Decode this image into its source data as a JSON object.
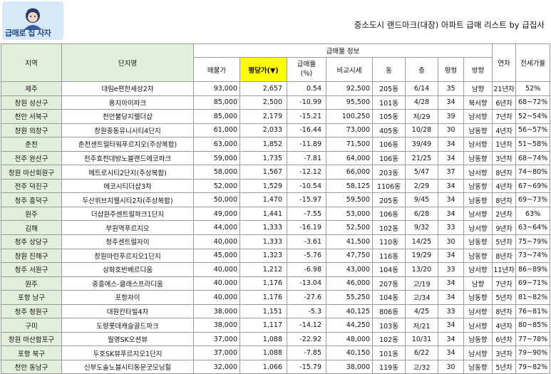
{
  "logo": {
    "text": "급매로 집 사자"
  },
  "title": "중소도시 랜드마크(대장) 아파트 급매 리스트 by 급집사",
  "headers": {
    "region": "지역",
    "complex": "단지명",
    "group": "급매물 정보",
    "price": "매물가",
    "per_pyeong": "평당가(▼)",
    "drop": "급매율\n(%)",
    "compare": "비교시세",
    "dong": "동",
    "floor": "층",
    "pyeong": "평형",
    "direction": "방향",
    "year": "연차",
    "jeonse": "전세가율"
  },
  "rows": [
    {
      "region": "제주",
      "complex": "대림e편한세상2차",
      "price": "93,000",
      "per_pyeong": "2,657",
      "drop": "0.54",
      "compare": "92,500",
      "dong": "205동",
      "floor": "6/14",
      "pyeong": "35",
      "direction": "남향",
      "year": "21년차",
      "jeonse": "52%"
    },
    {
      "region": "창원 성산구",
      "complex": "용지아이파크",
      "price": "85,000",
      "per_pyeong": "2,500",
      "drop": "-10.99",
      "compare": "95,500",
      "dong": "101동",
      "floor": "4/28",
      "pyeong": "34",
      "direction": "북서향",
      "year": "6년차",
      "jeonse": "68~72%"
    },
    {
      "region": "천안 서북구",
      "complex": "천안불당지웰더샵",
      "price": "85,000",
      "per_pyeong": "2,179",
      "drop": "-15.21",
      "compare": "100,250",
      "dong": "105동",
      "floor": "저/29",
      "pyeong": "39",
      "direction": "남서향",
      "year": "7년차",
      "jeonse": "52~54%"
    },
    {
      "region": "창원 의창구",
      "complex": "창원중동유니시티4단지",
      "price": "61,000",
      "per_pyeong": "2,033",
      "drop": "-16.44",
      "compare": "73,000",
      "dong": "405동",
      "floor": "10/28",
      "pyeong": "30",
      "direction": "남동향",
      "year": "4년차",
      "jeonse": "56~57%"
    },
    {
      "region": "춘천",
      "complex": "춘천센트럴타워푸르지오(주상복합)",
      "price": "63,000",
      "per_pyeong": "1,852",
      "drop": "-11.89",
      "compare": "71,500",
      "dong": "106동",
      "floor": "39/49",
      "pyeong": "34",
      "direction": "남서향",
      "year": "1년차",
      "jeonse": "51~58%"
    },
    {
      "region": "전주 완산구",
      "complex": "전주효천대방노블랜드에코파크",
      "price": "59,000",
      "per_pyeong": "1,735",
      "drop": "-7.81",
      "compare": "64,000",
      "dong": "106동",
      "floor": "21/25",
      "pyeong": "34",
      "direction": "남동향",
      "year": "3년차",
      "jeonse": "68~74%"
    },
    {
      "region": "창원 마산회원구",
      "complex": "메트로시티2단지(주상복합)",
      "price": "58,000",
      "per_pyeong": "1,567",
      "drop": "-12.12",
      "compare": "66,000",
      "dong": "203동",
      "floor": "5/47",
      "pyeong": "37",
      "direction": "남서향",
      "year": "8년차",
      "jeonse": "74~80%"
    },
    {
      "region": "전주 덕진구",
      "complex": "에코시티더샵3차",
      "price": "52,000",
      "per_pyeong": "1,529",
      "drop": "-10.54",
      "compare": "58,125",
      "dong": "1106동",
      "floor": "2/29",
      "pyeong": "34",
      "direction": "남동향",
      "year": "4년차",
      "jeonse": "67~69%"
    },
    {
      "region": "청주 흥덕구",
      "complex": "두산위브지웰시티2차(주상복합)",
      "price": "50,000",
      "per_pyeong": "1,470",
      "drop": "-15.97",
      "compare": "59,500",
      "dong": "205동",
      "floor": "9/45",
      "pyeong": "34",
      "direction": "남동향",
      "year": "8년차",
      "jeonse": "69~73%"
    },
    {
      "region": "원주",
      "complex": "더샵원주센트럴파크1단지",
      "price": "49,000",
      "per_pyeong": "1,441",
      "drop": "-7.55",
      "compare": "53,000",
      "dong": "106동",
      "floor": "6/28",
      "pyeong": "34",
      "direction": "남서향",
      "year": "2년차",
      "jeonse": "63%"
    },
    {
      "region": "김해",
      "complex": "부원역푸르지오",
      "price": "44,000",
      "per_pyeong": "1,333",
      "drop": "-16.19",
      "compare": "52,500",
      "dong": "102동",
      "floor": "9/32",
      "pyeong": "33",
      "direction": "남서향",
      "year": "9년차",
      "jeonse": "63~64%"
    },
    {
      "region": "청주 상당구",
      "complex": "청주센트럴자이",
      "price": "40,000",
      "per_pyeong": "1,333",
      "drop": "-3.61",
      "compare": "41,500",
      "dong": "110동",
      "floor": "14/25",
      "pyeong": "30",
      "direction": "남동향",
      "year": "5년차",
      "jeonse": "75~79%"
    },
    {
      "region": "창원 진해구",
      "complex": "창원마린푸르지오1단지",
      "price": "45,000",
      "per_pyeong": "1,323",
      "drop": "-5.76",
      "compare": "47,750",
      "dong": "116동",
      "floor": "19/29",
      "pyeong": "34",
      "direction": "남동향",
      "year": "8년차",
      "jeonse": "73~74%"
    },
    {
      "region": "청주 서원구",
      "complex": "성화호반베르디움",
      "price": "40,000",
      "per_pyeong": "1,212",
      "drop": "-6.98",
      "compare": "43,000",
      "dong": "104동",
      "floor": "13/20",
      "pyeong": "33",
      "direction": "남서향",
      "year": "11년차",
      "jeonse": "86~89%"
    },
    {
      "region": "원주",
      "complex": "중흥에스-클래스프라디움",
      "price": "40,000",
      "per_pyeong": "1,176",
      "drop": "-13.04",
      "compare": "46,000",
      "dong": "207동",
      "floor": "고/19",
      "pyeong": "34",
      "direction": "남향",
      "year": "7년차",
      "jeonse": "69~71%"
    },
    {
      "region": "포항 남구",
      "complex": "포항자이",
      "price": "40,000",
      "per_pyeong": "1,176",
      "drop": "-27.6",
      "compare": "55,250",
      "dong": "104동",
      "floor": "고/34",
      "pyeong": "34",
      "direction": "남동향",
      "year": "5년차",
      "jeonse": "81~82%"
    },
    {
      "region": "청주 청원구",
      "complex": "대원칸타빌4차",
      "price": "38,000",
      "per_pyeong": "1,151",
      "drop": "-5.3",
      "compare": "40,125",
      "dong": "806동",
      "floor": "4/25",
      "pyeong": "33",
      "direction": "남서향",
      "year": "8년차",
      "jeonse": "76~81%"
    },
    {
      "region": "구미",
      "complex": "도량롯데캐슬골드파크",
      "price": "38,000",
      "per_pyeong": "1,117",
      "drop": "-14.12",
      "compare": "44,250",
      "dong": "103동",
      "floor": "저/21",
      "pyeong": "34",
      "direction": "남서향",
      "year": "4년차",
      "jeonse": "80~85%"
    },
    {
      "region": "창원 마산합포구",
      "complex": "월영SK오션뷰",
      "price": "37,000",
      "per_pyeong": "1,088",
      "drop": "-22.92",
      "compare": "48,000",
      "dong": "102동",
      "floor": "10/31",
      "pyeong": "34",
      "direction": "남동향",
      "year": "6년차",
      "jeonse": "77~78%"
    },
    {
      "region": "포항 북구",
      "complex": "두호SK뷰푸르지오1단지",
      "price": "37,000",
      "per_pyeong": "1,088",
      "drop": "-7.85",
      "compare": "40,150",
      "dong": "101동",
      "floor": "6/22",
      "pyeong": "34",
      "direction": "남서향",
      "year": "3년차",
      "jeonse": "79~90%"
    },
    {
      "region": "천안 동남구",
      "complex": "신부도솔노블시티동문굿모닝힐",
      "price": "32,000",
      "per_pyeong": "1,066",
      "drop": "-15.79",
      "compare": "38,000",
      "dong": "119동",
      "floor": "고/32",
      "pyeong": "30",
      "direction": "남동향",
      "year": "5년차",
      "jeonse": "79~82%"
    }
  ]
}
